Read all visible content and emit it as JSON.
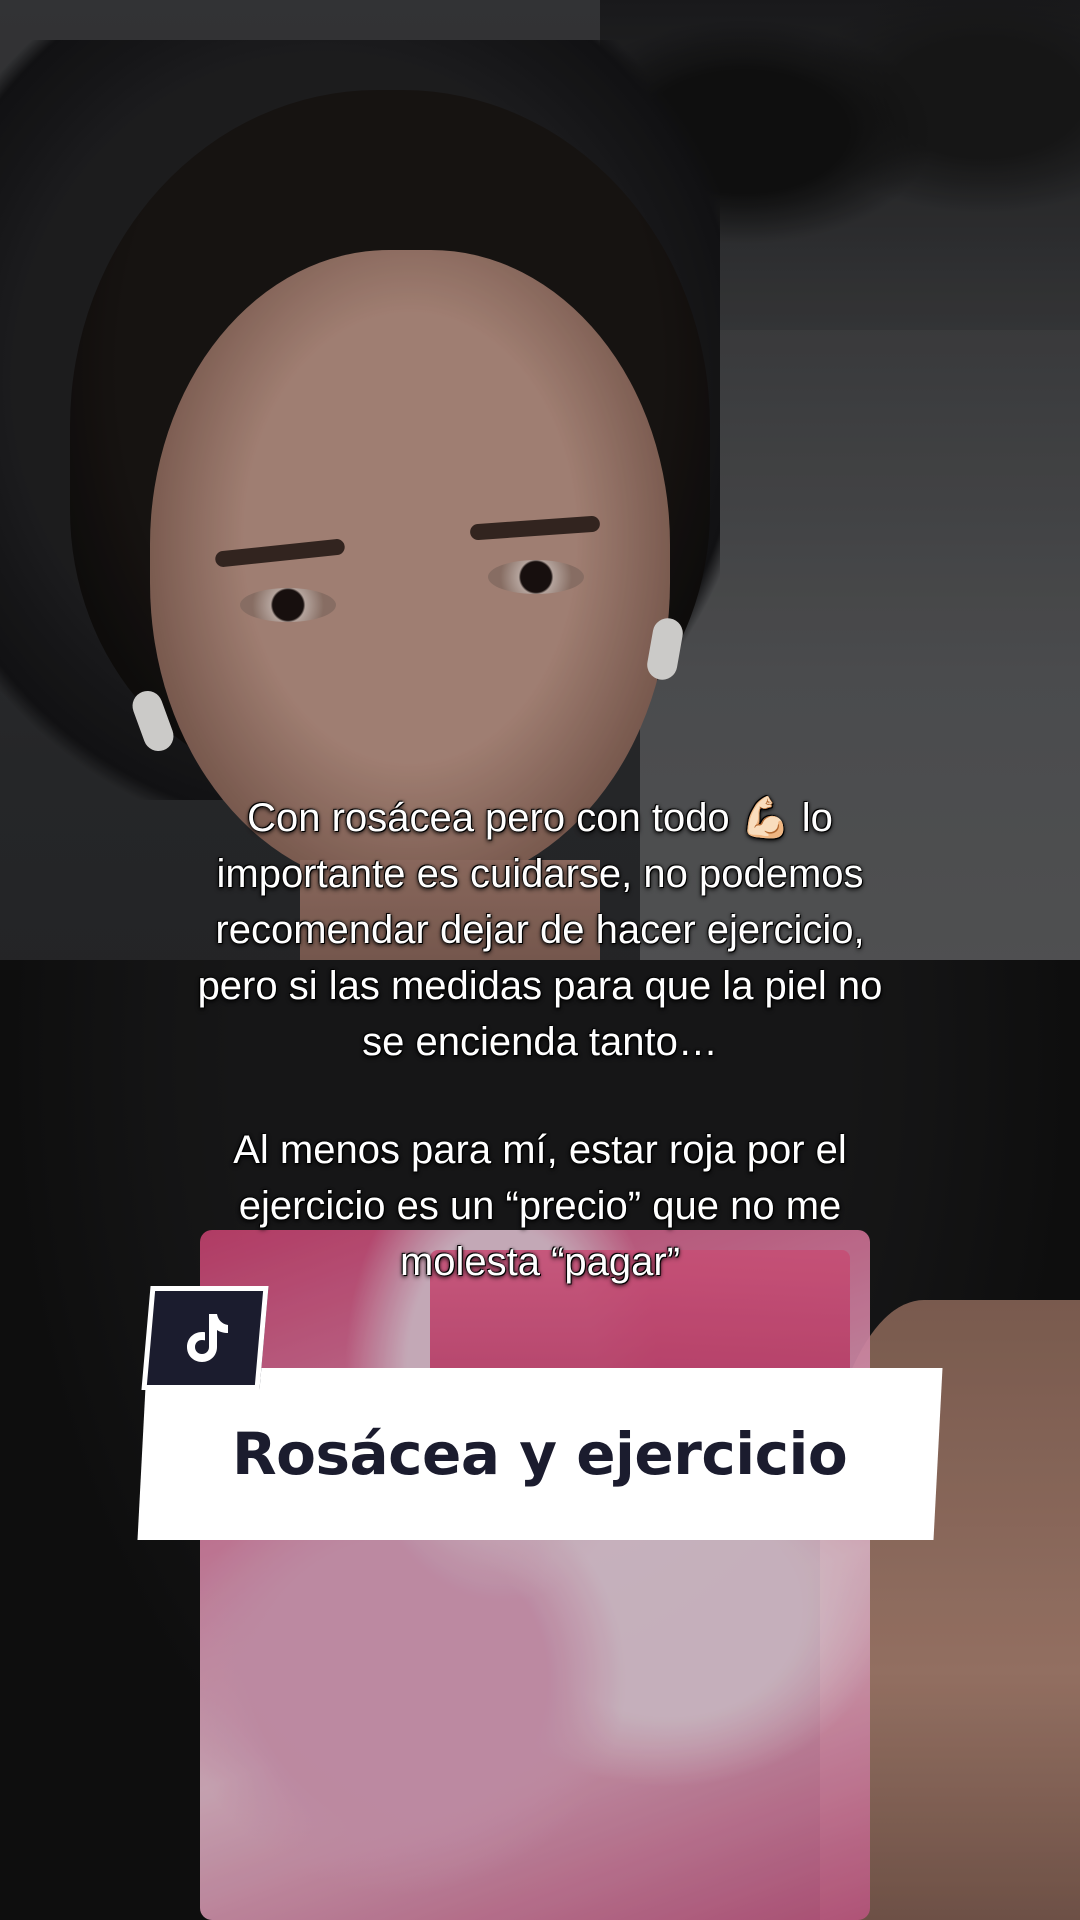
{
  "caption": {
    "line1": "Con rosácea pero con todo 💪🏻 lo",
    "line2": "importante es cuidarse, no podemos",
    "line3": "recomendar dejar de hacer ejercicio,",
    "line4": "pero si las medidas para que la piel no",
    "line5": "se encienda tanto…",
    "line6": "Al menos para mí, estar roja por el",
    "line7": "ejercicio es un “precio” que no me",
    "line8": "molesta “pagar”"
  },
  "title_card": {
    "text": "Rosácea y ejercicio"
  },
  "logo": {
    "icon": "tiktok-note-icon"
  },
  "colors": {
    "title_text": "#1b1c2e",
    "card_bg": "#ffffff",
    "logo_bg": "#1b1c2e",
    "caption_text": "#ffffff"
  }
}
